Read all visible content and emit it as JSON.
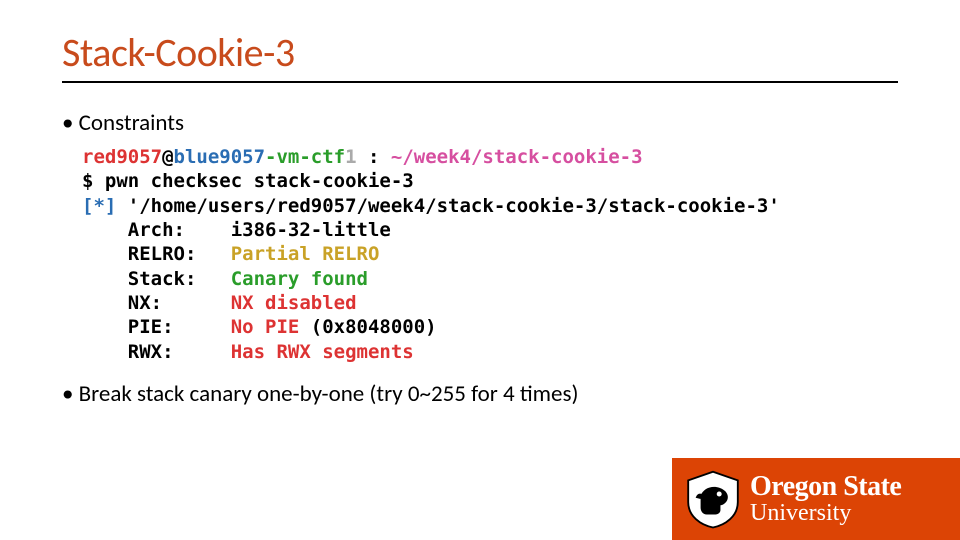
{
  "title": "Stack-Cookie-3",
  "bullets": {
    "b1": "Constraints",
    "b2": "Break stack canary one-by-one (try 0~255 for 4 times)"
  },
  "terminal": {
    "prompt": {
      "user": "red9057",
      "at": "@",
      "host1": "blue9057",
      "host2": "-vm-ctf",
      "host3": "1",
      "sep1": " : ",
      "cwd": "~/week4/stack-cookie-3"
    },
    "cmd_prefix": "$",
    "cmd": " pwn checksec stack-cookie-3",
    "star": "[*]",
    "path": " '/home/users/red9057/week4/stack-cookie-3/stack-cookie-3'",
    "rows": {
      "arch": {
        "label": "Arch:    ",
        "val": "i386-32-little"
      },
      "relro": {
        "label": "RELRO:   ",
        "val": "Partial RELRO"
      },
      "stack": {
        "label": "Stack:   ",
        "val": "Canary found"
      },
      "nx": {
        "label": "NX:      ",
        "val": "NX disabled"
      },
      "pie": {
        "label": "PIE:     ",
        "val_a": "No PIE ",
        "val_b": "(0x8048000)"
      },
      "rwx": {
        "label": "RWX:     ",
        "val": "Has RWX segments"
      }
    }
  },
  "logo": {
    "line1": "Oregon State",
    "line2": "University"
  }
}
